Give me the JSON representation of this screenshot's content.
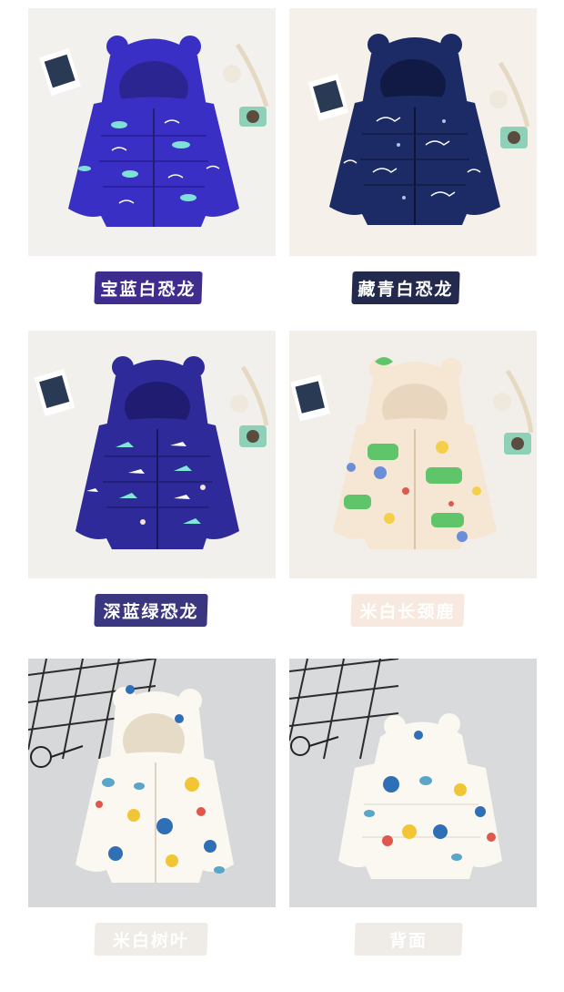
{
  "products": [
    {
      "label": "宝蓝白恐龙",
      "label_bg": "#3e2d8f",
      "bg": "#f3f1ee",
      "jacket": "#3a2fc4",
      "jacket_dark": "#2a20a0",
      "lining": "#2a2590",
      "prints": [
        "#7ee0d8",
        "#ffffff",
        "#5ad1e0"
      ]
    },
    {
      "label": "藏青白恐龙",
      "label_bg": "#242a4e",
      "bg": "#f5f0ea",
      "jacket": "#1c2b66",
      "jacket_dark": "#141f4c",
      "lining": "#101a44",
      "prints": [
        "#ffffff",
        "#c8d6ea",
        "#a9c4e4"
      ]
    },
    {
      "label": "深蓝绿恐龙",
      "label_bg": "#3b3680",
      "bg": "#f2f0ec",
      "jacket": "#2f2a9a",
      "jacket_dark": "#22207a",
      "lining": "#1f1c72",
      "prints": [
        "#7fe6d8",
        "#ffffff",
        "#f1e6d6"
      ]
    },
    {
      "label": "米白长颈鹿",
      "label_bg": "#f7e9df",
      "bg": "#f2efea",
      "jacket": "#f6e7d4",
      "jacket_dark": "#ead7c0",
      "lining": "#e9d6bf",
      "prints": [
        "#5fc46a",
        "#f4d04a",
        "#6a8fd8",
        "#e0584e"
      ]
    },
    {
      "label": "米白树叶",
      "label_bg": "#efebe6",
      "bg": "#d7d8da",
      "jacket": "#fbf8f1",
      "jacket_dark": "#ece7dd",
      "lining": "#e6dbc7",
      "prints": [
        "#2f6fb6",
        "#f2c534",
        "#e0574b",
        "#5aa6c9"
      ]
    },
    {
      "label": "背面",
      "label_bg": "#efebe6",
      "bg": "#d9dadc",
      "jacket": "#fbf8f1",
      "jacket_dark": "#ece7dd",
      "lining": "#e6dbc7",
      "prints": [
        "#2f6fb6",
        "#f2c534",
        "#e0574b",
        "#5aa6c9"
      ]
    }
  ]
}
